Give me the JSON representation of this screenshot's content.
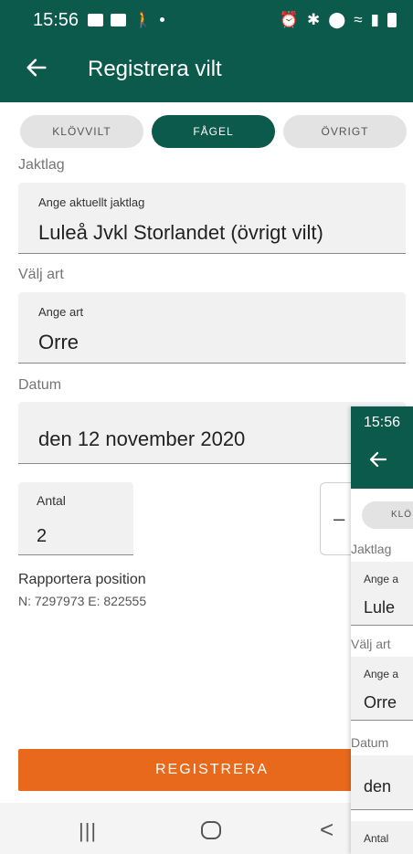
{
  "status_bar": {
    "time": "15:56"
  },
  "app_bar": {
    "title": "Registrera vilt"
  },
  "tabs": [
    {
      "label": "KLÖVVILT"
    },
    {
      "label": "FÅGEL"
    },
    {
      "label": "ÖVRIGT"
    }
  ],
  "sections": {
    "jaktlag": "Jaktlag",
    "valj_art": "Välj art",
    "datum": "Datum"
  },
  "fields": {
    "jaktlag": {
      "label": "Ange aktuellt jaktlag",
      "value": "Luleå Jvkl Storlandet (övrigt vilt)"
    },
    "art": {
      "label": "Ange art",
      "value": "Orre"
    },
    "datum": {
      "value": "den 12 november 2020"
    },
    "antal": {
      "label": "Antal",
      "value": "2"
    }
  },
  "stepper": {
    "minus_label": "–"
  },
  "position": {
    "title": "Rapportera position",
    "coords": "N: 7297973  E: 822555"
  },
  "register_button": {
    "label": "REGISTRERA"
  },
  "nav_bar": {
    "recent": "|||",
    "back": "<"
  },
  "overlay": {
    "time": "15:56",
    "tab_label": "KLÖ",
    "jaktlag_section": "Jaktlag",
    "jaktlag_label": "Ange a",
    "jaktlag_value": "Lule",
    "valj_art_section": "Välj art",
    "art_label": "Ange a",
    "art_value": "Orre",
    "datum_section": "Datum",
    "datum_value": "den",
    "antal_label": "Antal"
  },
  "colors": {
    "primary": "#0b5a4c",
    "accent": "#e8691c",
    "field_bg": "#f1f1f1"
  },
  "icons": {
    "back": "arrow-left-icon",
    "home": "home-icon",
    "recent": "recent-apps-icon",
    "nav_back": "chevron-left-icon"
  }
}
